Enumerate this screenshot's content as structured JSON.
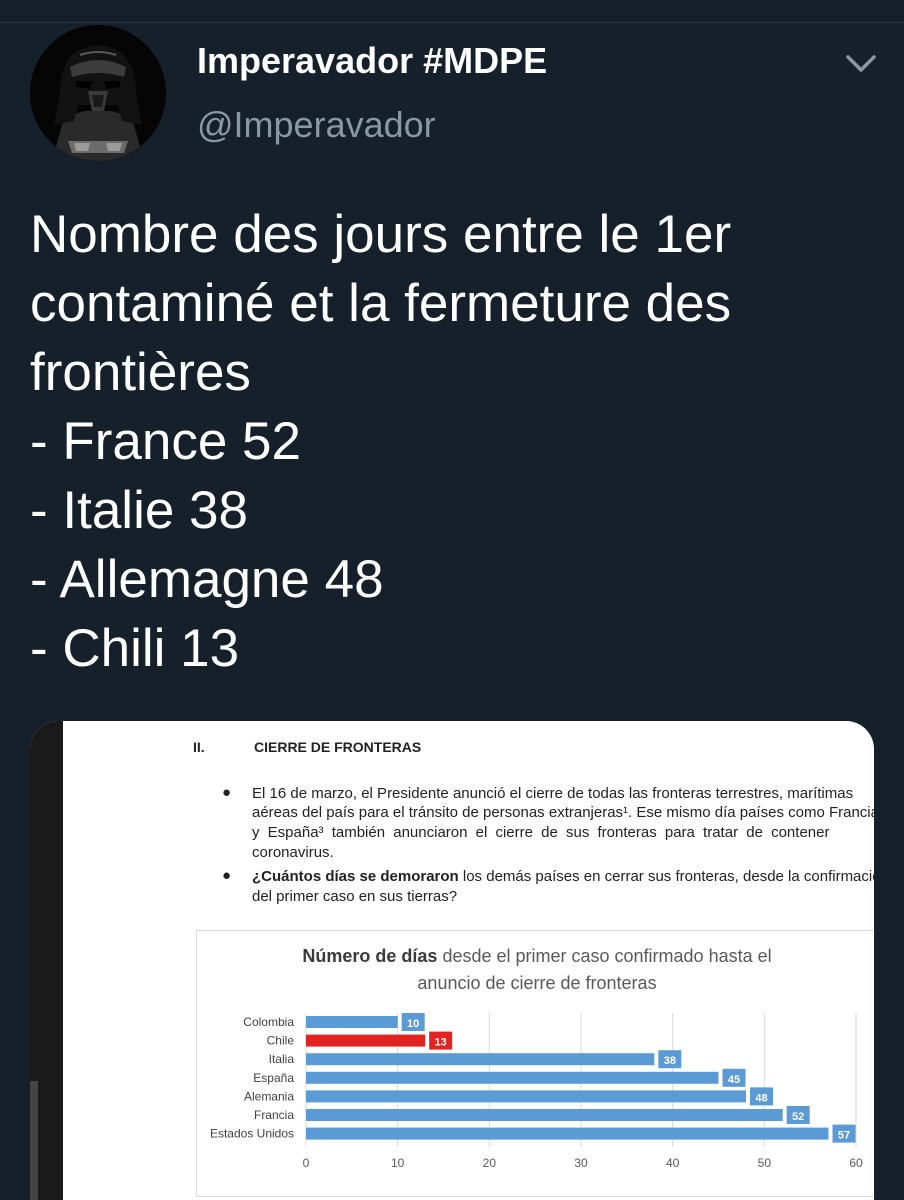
{
  "tweet": {
    "display_name": "Imperavador #MDPE",
    "handle": "@Imperavador",
    "text_lines": [
      "Nombre des jours entre le 1er",
      "contaminé et la fermeture des",
      "frontières",
      "- France 52",
      "- Italie 38",
      "- Allemagne 48",
      "- Chili 13"
    ]
  },
  "icons": {
    "avatar": "darth-vader-avatar",
    "menu": "chevron-down-icon",
    "bullet": "bullet-icon"
  },
  "document": {
    "section_number": "II.",
    "section_title": "CIERRE DE FRONTERAS",
    "bullet1_lines": [
      "El 16 de marzo, el Presidente anunció el cierre de todas las fronteras terrestres, marítimas",
      "aéreas del país para el tránsito de personas extranjeras¹. Ese mismo día países como Francia",
      "y España³ también anunciaron el cierre de sus fronteras para tratar de contener",
      "coronavirus."
    ],
    "bullet2_bold": "¿Cuántos días se demoraron",
    "bullet2_rest": " los demás países en cerrar sus fronteras, desde la confirmación",
    "bullet2_line2": "del primer caso en sus tierras?"
  },
  "chart_data": {
    "type": "bar",
    "orientation": "horizontal",
    "title_bold": "Número de días",
    "title_rest": " desde el primer caso confirmado hasta el",
    "title_line2": "anuncio de cierre de fronteras",
    "categories": [
      "Colombia",
      "Chile",
      "Italia",
      "España",
      "Alemania",
      "Francia",
      "Estados Unidos"
    ],
    "values": [
      10,
      13,
      38,
      45,
      48,
      52,
      57
    ],
    "highlight": "Chile",
    "colors": {
      "default": "#5b9bd5",
      "highlight": "#e32222",
      "grid": "#d9d9d9",
      "label_text": "#ffffff"
    },
    "xlim": [
      0,
      60
    ],
    "xticks": [
      0,
      10,
      20,
      30,
      40,
      50,
      60
    ],
    "grid": true,
    "legend": "none"
  },
  "colors": {
    "background": "#15202b",
    "handle": "#8899a6",
    "text": "#ffffff"
  }
}
